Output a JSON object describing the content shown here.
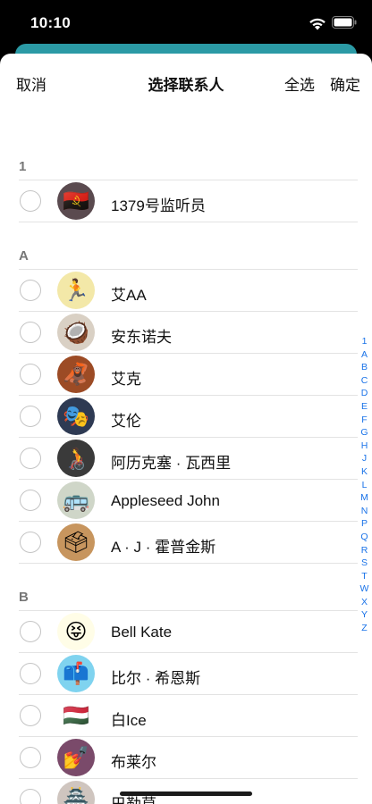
{
  "status_bar": {
    "time": "10:10"
  },
  "nav": {
    "cancel": "取消",
    "title": "选择联系人",
    "select_all": "全选",
    "confirm": "确定"
  },
  "sections": [
    {
      "letter": "1",
      "contacts": [
        {
          "name": "1379号监听员",
          "avatar": "angola-flag",
          "avatar_bg": "#5a4a4f"
        }
      ]
    },
    {
      "letter": "A",
      "contacts": [
        {
          "name": "艾AA",
          "avatar": "runner-emoji",
          "avatar_bg": "#f3e8a8"
        },
        {
          "name": "安东诺夫",
          "avatar": "coconut-emoji",
          "avatar_bg": "#d9d0c4"
        },
        {
          "name": "艾克",
          "avatar": "orangutan-emoji",
          "avatar_bg": "#9c4b25"
        },
        {
          "name": "艾伦",
          "avatar": "performing-arts-emoji",
          "avatar_bg": "#2e3a53"
        },
        {
          "name": "阿历克塞 · 瓦西里",
          "avatar": "wheelchair-emoji",
          "avatar_bg": "#3a3a3a"
        },
        {
          "name": "Appleseed John",
          "avatar": "bus-emoji",
          "avatar_bg": "#cfd6c8"
        },
        {
          "name": "A · J · 霍普金斯",
          "avatar": "ballot-box-emoji",
          "avatar_bg": "#c7955e"
        }
      ]
    },
    {
      "letter": "B",
      "contacts": [
        {
          "name": "Bell Kate",
          "avatar": "tongue-face-emoji",
          "avatar_bg": "#fffde7"
        },
        {
          "name": "比尔 · 希恩斯",
          "avatar": "mailbox-emoji",
          "avatar_bg": "#7fd3ef"
        },
        {
          "name": "白Ice",
          "avatar": "hungary-flag",
          "avatar_bg": "#ffffff"
        },
        {
          "name": "布莱尔",
          "avatar": "nail-polish-emoji",
          "avatar_bg": "#7a4a6a"
        },
        {
          "name": "巴勒莫",
          "avatar": "japanese-castle-emoji",
          "avatar_bg": "#cfc5bf"
        }
      ]
    }
  ],
  "index_letters": [
    "1",
    "A",
    "B",
    "C",
    "D",
    "E",
    "F",
    "G",
    "H",
    "J",
    "K",
    "L",
    "M",
    "N",
    "P",
    "Q",
    "R",
    "S",
    "T",
    "W",
    "X",
    "Y",
    "Z"
  ]
}
